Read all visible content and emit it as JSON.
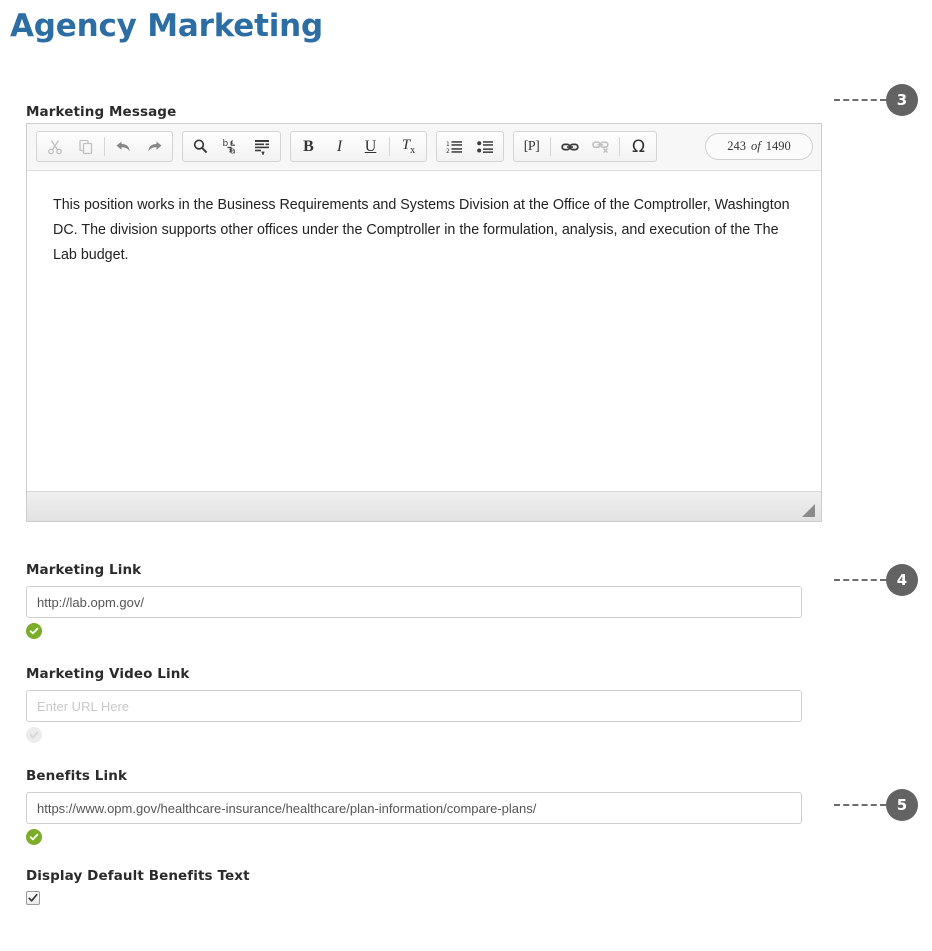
{
  "page": {
    "title": "Agency Marketing"
  },
  "marketing_message": {
    "label": "Marketing Message",
    "body_text": "This position works in the Business Requirements and Systems Division at the Office of the Comptroller, Washington DC. The division supports other offices under the Comptroller in the formulation, analysis, and execution of the The Lab budget.",
    "toolbar": {
      "cut": "Cut",
      "copy": "Copy",
      "undo": "Undo",
      "redo": "Redo",
      "find": "Find",
      "replace": "Replace",
      "select_all": "Select All",
      "bold": "B",
      "italic": "I",
      "underline": "U",
      "remove_format": "Tx",
      "numbered_list": "Insert/Remove Numbered List",
      "bulleted_list": "Insert/Remove Bulleted List",
      "paragraph_format": "[P]",
      "link": "Link",
      "unlink": "Unlink",
      "special_char": "Ω"
    },
    "counter": {
      "current": "243",
      "separator": "of",
      "max": "1490"
    }
  },
  "marketing_link": {
    "label": "Marketing Link",
    "value": "http://lab.opm.gov/",
    "placeholder": "Enter URL Here",
    "status": "valid"
  },
  "marketing_video_link": {
    "label": "Marketing Video Link",
    "value": "",
    "placeholder": "Enter URL Here",
    "status": "empty"
  },
  "benefits_link": {
    "label": "Benefits Link",
    "value": "https://www.opm.gov/healthcare-insurance/healthcare/plan-information/compare-plans/",
    "placeholder": "Enter URL Here",
    "status": "valid"
  },
  "display_default_benefits": {
    "label": "Display Default Benefits Text",
    "checked": true
  },
  "callouts": [
    {
      "number": "3"
    },
    {
      "number": "4"
    },
    {
      "number": "5"
    }
  ],
  "colors": {
    "title": "#2c6ea3",
    "callout": "#636363",
    "valid_check": "#7aad29"
  }
}
